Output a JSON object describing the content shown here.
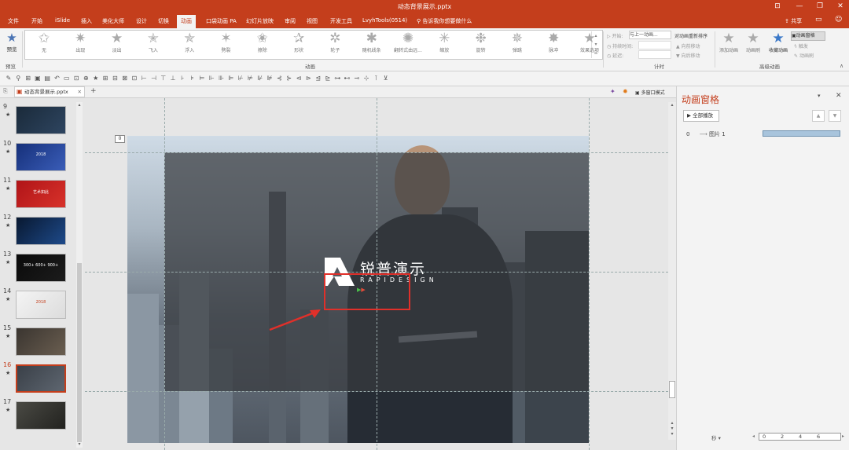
{
  "window": {
    "title": "动态背景展示.pptx",
    "buttons": [
      "⊡",
      "—",
      "❐",
      "✕"
    ]
  },
  "tabs": [
    "文件",
    "开始",
    "iSlide",
    "插入",
    "美化大师",
    "设计",
    "切换",
    "动画",
    "口袋动画 PA",
    "幻灯片放映",
    "审阅",
    "视图",
    "开发工具",
    "LvyhTools(0514)"
  ],
  "active_tab": "动画",
  "tell_me": "告诉我你想要做什么",
  "share_label": "共享",
  "ribbon": {
    "preview_label": "预览",
    "preview_group": "预览",
    "animation_group": "动画",
    "effects": [
      "无",
      "出现",
      "淡出",
      "飞入",
      "浮入",
      "劈裂",
      "擦除",
      "形状",
      "轮子",
      "随机线条",
      "翻转式由远...",
      "缩放",
      "旋转",
      "弹跳",
      "脉冲"
    ],
    "effect_options": "效果选项",
    "timing": {
      "start_label": "开始:",
      "start_value": "与上一动画...",
      "duration_label": "持续时间:",
      "delay_label": "延迟:",
      "reorder": "对动画重新排序",
      "move_earlier": "向前移动",
      "move_later": "向后移动",
      "group": "计时"
    },
    "advanced": {
      "add": "添加动画",
      "painter": "动画刷",
      "pane": "动画窗格",
      "trigger": "触发",
      "brush": "动画刷",
      "collect": "收藏动画",
      "group": "高级动画"
    }
  },
  "doc_tab": "动态背景展示.pptx",
  "multi_window": "多窗口模式",
  "thumbnails": [
    {
      "num": "9",
      "star": "★",
      "colors": [
        "#1a2a3a",
        "#2e4560"
      ]
    },
    {
      "num": "10",
      "star": "★",
      "colors": [
        "#16307a",
        "#3a5db8"
      ],
      "caption": "2018"
    },
    {
      "num": "11",
      "star": "★",
      "colors": [
        "#b01418",
        "#d8322a"
      ],
      "caption": "艺术如此"
    },
    {
      "num": "12",
      "star": "★",
      "colors": [
        "#081830",
        "#1e4a8a"
      ]
    },
    {
      "num": "13",
      "star": "★",
      "colors": [
        "#0a0a0a",
        "#1c1c1c"
      ],
      "caption": "300+ 600+ 900+"
    },
    {
      "num": "14",
      "star": "★",
      "colors": [
        "#f4f4f4",
        "#dcdcdc"
      ],
      "caption": "2018"
    },
    {
      "num": "15",
      "star": "★",
      "colors": [
        "#3a3530",
        "#6a5e50"
      ]
    },
    {
      "num": "16",
      "star": "★",
      "colors": [
        "#3a4048",
        "#5e6670"
      ]
    },
    {
      "num": "17",
      "star": "★",
      "colors": [
        "#4a4a44",
        "#22221f"
      ]
    }
  ],
  "active_thumb": "16",
  "slide": {
    "tag": "0",
    "logo_cn": "锐普演示",
    "logo_en": "RAPIDESIGN"
  },
  "anim_pane": {
    "title": "动画窗格",
    "play_all": "全部播放",
    "item_index": "0",
    "item_label": "图片 1",
    "seconds": "秒 ▾",
    "timeline_ticks": [
      "0",
      "2",
      "4",
      "6"
    ]
  },
  "colors": {
    "accent": "#c43e1c",
    "highlight": "#e0302a"
  }
}
